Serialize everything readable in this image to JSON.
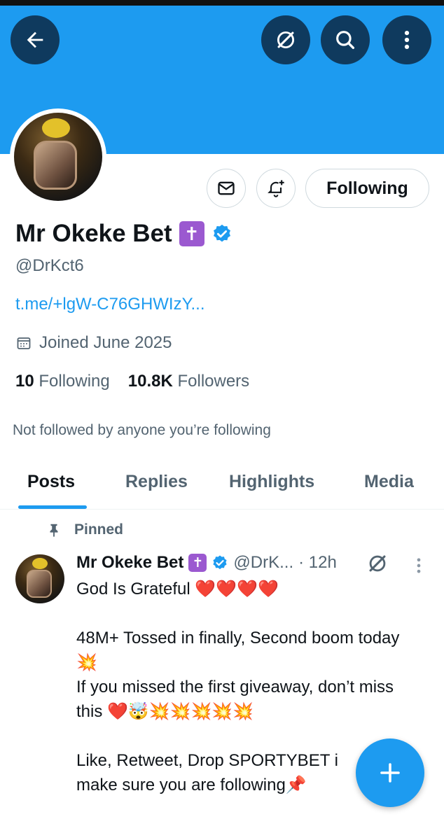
{
  "header": {
    "back_icon": "back-arrow-icon",
    "grok_icon": "grok-icon",
    "search_icon": "search-icon",
    "more_icon": "more-vertical-icon",
    "banner_color": "#1d9bf0"
  },
  "profile": {
    "name": "Mr Okeke Bet",
    "badge_glyph": "✝",
    "handle": "@DrKct6",
    "link": "t.me/+lgW-C76GHWIzY...",
    "joined": "Joined June 2025",
    "following_count": "10",
    "following_label": "Following",
    "followers_count": "10.8K",
    "followers_label": "Followers",
    "not_followed": "Not followed by anyone you’re following"
  },
  "actions": {
    "message_icon": "mail-icon",
    "notify_icon": "bell-plus-icon",
    "following_button": "Following"
  },
  "tabs": [
    {
      "label": "Posts",
      "active": true
    },
    {
      "label": "Replies",
      "active": false
    },
    {
      "label": "Highlights",
      "active": false
    },
    {
      "label": "Media",
      "active": false
    }
  ],
  "post": {
    "pinned_label": "Pinned",
    "author": "Mr Okeke Bet",
    "badge_glyph": "✝",
    "handle": "@DrK...",
    "time": "· 12h",
    "body": "God Is Grateful ❤️❤️❤️❤️\n\n48M+ Tossed in finally, Second boom today 💥\nIf you missed the first giveaway, don’t miss this ❤️🤯💥💥💥💥💥\n\nLike, Retweet, Drop SPORTYBET i\nmake sure you are following📌"
  },
  "fab": {
    "icon": "plus-icon",
    "color": "#1d9bf0"
  }
}
